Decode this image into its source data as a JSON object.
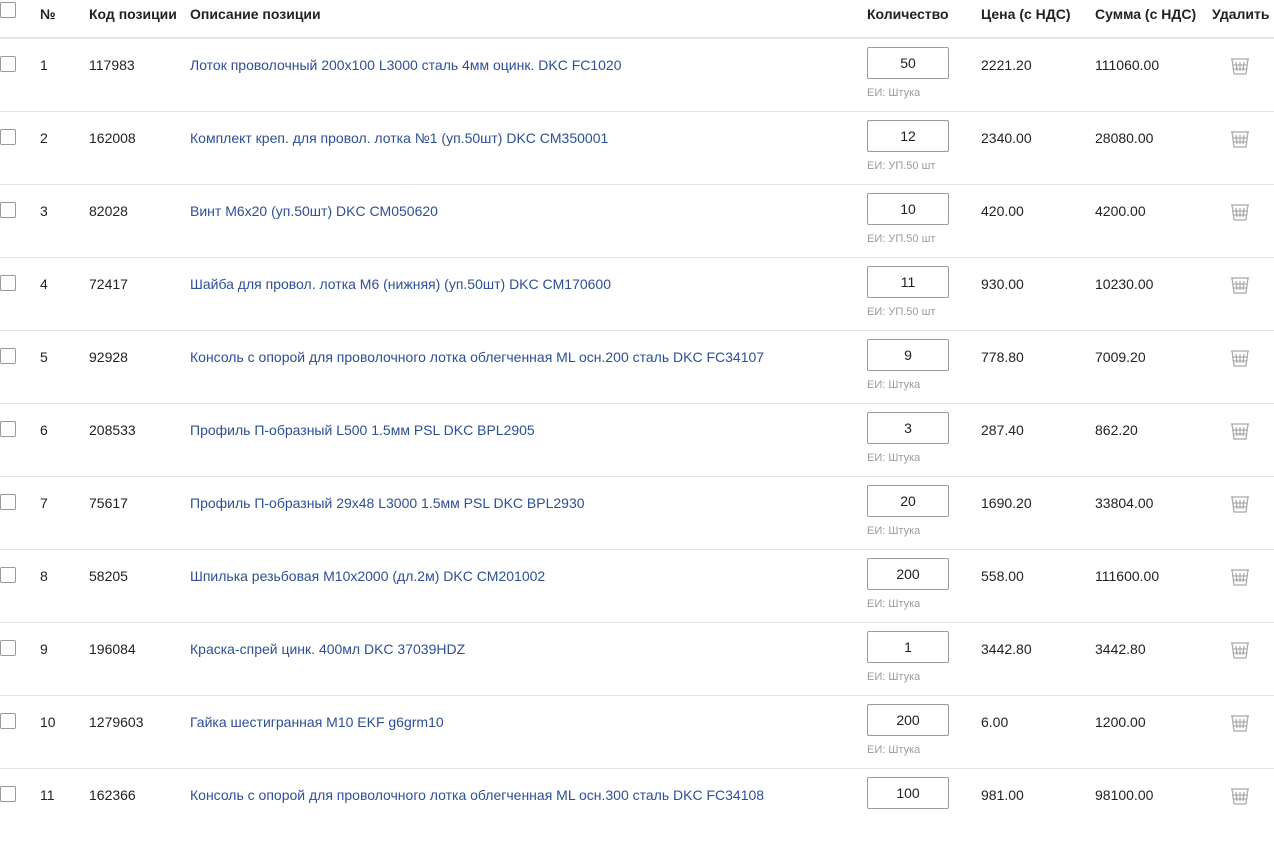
{
  "header": {
    "number": "№",
    "code": "Код позиции",
    "description": "Описание позиции",
    "quantity": "Количество",
    "price": "Цена (с НДС)",
    "sum": "Сумма (с НДС)",
    "delete": "Удалить"
  },
  "rows": [
    {
      "num": "1",
      "code": "117983",
      "description": "Лоток проволочный 200x100 L3000 сталь 4мм оцинк. DKC FC1020",
      "qty": "50",
      "unit": "ЕИ: Штука",
      "price": "2221.20",
      "sum": "111060.00"
    },
    {
      "num": "2",
      "code": "162008",
      "description": "Комплект креп. для провол. лотка №1 (уп.50шт) DKC CM350001",
      "qty": "12",
      "unit": "ЕИ: УП.50 шт",
      "price": "2340.00",
      "sum": "28080.00"
    },
    {
      "num": "3",
      "code": "82028",
      "description": "Винт M6x20 (уп.50шт) DKC CM050620",
      "qty": "10",
      "unit": "ЕИ: УП.50 шт",
      "price": "420.00",
      "sum": "4200.00"
    },
    {
      "num": "4",
      "code": "72417",
      "description": "Шайба для провол. лотка M6 (нижняя) (уп.50шт) DKC CM170600",
      "qty": "11",
      "unit": "ЕИ: УП.50 шт",
      "price": "930.00",
      "sum": "10230.00"
    },
    {
      "num": "5",
      "code": "92928",
      "description": "Консоль с опорой для проволочного лотка облегченная ML осн.200 сталь DKC FC34107",
      "qty": "9",
      "unit": "ЕИ: Штука",
      "price": "778.80",
      "sum": "7009.20"
    },
    {
      "num": "6",
      "code": "208533",
      "description": "Профиль П-образный L500 1.5мм PSL DKC BPL2905",
      "qty": "3",
      "unit": "ЕИ: Штука",
      "price": "287.40",
      "sum": "862.20"
    },
    {
      "num": "7",
      "code": "75617",
      "description": "Профиль П-образный 29x48 L3000 1.5мм PSL DKC BPL2930",
      "qty": "20",
      "unit": "ЕИ: Штука",
      "price": "1690.20",
      "sum": "33804.00"
    },
    {
      "num": "8",
      "code": "58205",
      "description": "Шпилька резьбовая M10x2000 (дл.2м) DKC CM201002",
      "qty": "200",
      "unit": "ЕИ: Штука",
      "price": "558.00",
      "sum": "111600.00"
    },
    {
      "num": "9",
      "code": "196084",
      "description": "Краска-спрей цинк. 400мл DKC 37039HDZ",
      "qty": "1",
      "unit": "ЕИ: Штука",
      "price": "3442.80",
      "sum": "3442.80"
    },
    {
      "num": "10",
      "code": "1279603",
      "description": "Гайка шестигранная M10 EKF g6grm10",
      "qty": "200",
      "unit": "ЕИ: Штука",
      "price": "6.00",
      "sum": "1200.00"
    },
    {
      "num": "11",
      "code": "162366",
      "description": "Консоль с опорой для проволочного лотка облегченная ML осн.300 сталь DKC FC34108",
      "qty": "100",
      "unit": "",
      "price": "981.00",
      "sum": "98100.00"
    }
  ],
  "icons": {
    "checkbox": "checkbox-icon",
    "delete": "basket-icon"
  },
  "colors": {
    "link": "#2d4f98",
    "unit_text": "#9b9b9b",
    "divider": "#e4e4e4",
    "icon": "#a8a8a8"
  }
}
